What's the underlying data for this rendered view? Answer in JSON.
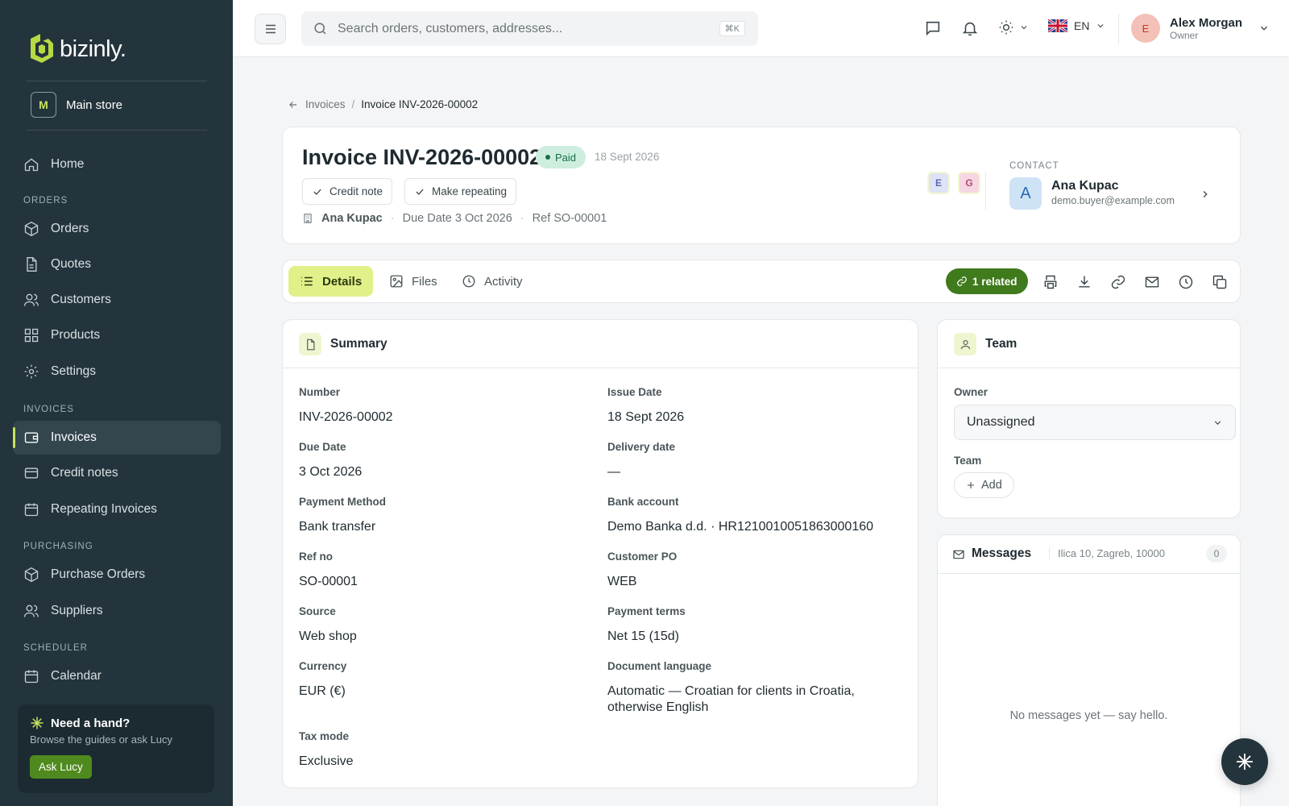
{
  "brand": {
    "name": "bizinly."
  },
  "store": {
    "badge": "M",
    "name": "Main store"
  },
  "sidebar": {
    "home": "Home",
    "sections": {
      "orders": "ORDERS",
      "invoices": "INVOICES",
      "purchasing": "PURCHASING",
      "scheduler": "SCHEDULER"
    },
    "items": [
      {
        "label": "Orders"
      },
      {
        "label": "Quotes"
      },
      {
        "label": "Customers"
      },
      {
        "label": "Products"
      },
      {
        "label": "Settings"
      },
      {
        "label": "Invoices"
      },
      {
        "label": "Credit notes"
      },
      {
        "label": "Repeating Invoices"
      },
      {
        "label": "Purchase Orders"
      },
      {
        "label": "Suppliers"
      },
      {
        "label": "Calendar"
      }
    ],
    "active": "Invoices"
  },
  "help": {
    "title": "Need a hand?",
    "subtitle": "Browse the guides or ask Lucy",
    "button": "Ask Lucy"
  },
  "topbar": {
    "search_placeholder": "Search orders, customers, addresses...",
    "search_shortcut": "⌘K",
    "language": "EN",
    "user": {
      "initial": "E",
      "name": "Alex Morgan",
      "role": "Owner"
    }
  },
  "breadcrumb": {
    "parent": "Invoices",
    "separator": "/",
    "current": "Invoice INV-2026-00002"
  },
  "invoice": {
    "title": "Invoice INV-2026-00002",
    "status": "Paid",
    "date": "18 Sept 2026",
    "actions": {
      "credit_note": "Credit note",
      "make_repeating": "Make repeating"
    },
    "customer": "Ana Kupac",
    "due": "Due Date 3 Oct 2026",
    "ref": "Ref SO-00001",
    "assignees": [
      "E",
      "G"
    ],
    "contact": {
      "label": "CONTACT",
      "initial": "A",
      "name": "Ana Kupac",
      "email": "demo.buyer@example.com"
    }
  },
  "tabs": {
    "details": "Details",
    "files": "Files",
    "activity": "Activity",
    "related": "1 related"
  },
  "summary": {
    "title": "Summary",
    "fields": {
      "number": {
        "label": "Number",
        "value": "INV-2026-00002"
      },
      "issue_date": {
        "label": "Issue Date",
        "value": "18 Sept 2026"
      },
      "due_date": {
        "label": "Due Date",
        "value": "3 Oct 2026"
      },
      "delivery_date": {
        "label": "Delivery date",
        "value": "—"
      },
      "payment_method": {
        "label": "Payment Method",
        "value": "Bank transfer"
      },
      "bank_account": {
        "label": "Bank account",
        "value": "Demo Banka d.d. · HR1210010051863000160"
      },
      "ref_no": {
        "label": "Ref no",
        "value": "SO-00001"
      },
      "customer_po": {
        "label": "Customer PO",
        "value": "WEB"
      },
      "source": {
        "label": "Source",
        "value": "Web shop"
      },
      "payment_terms": {
        "label": "Payment terms",
        "value": "Net 15 (15d)"
      },
      "currency": {
        "label": "Currency",
        "value": "EUR (€)"
      },
      "document_language": {
        "label": "Document language",
        "value": "Automatic — Croatian for clients in Croatia, otherwise English"
      },
      "tax_mode": {
        "label": "Tax mode",
        "value": "Exclusive"
      }
    }
  },
  "team": {
    "title": "Team",
    "owner_label": "Owner",
    "owner_value": "Unassigned",
    "team_label": "Team",
    "add_button": "Add"
  },
  "messages": {
    "title": "Messages",
    "address": "Ilica 10, Zagreb, 10000",
    "count": "0",
    "empty": "No messages yet — say hello."
  }
}
